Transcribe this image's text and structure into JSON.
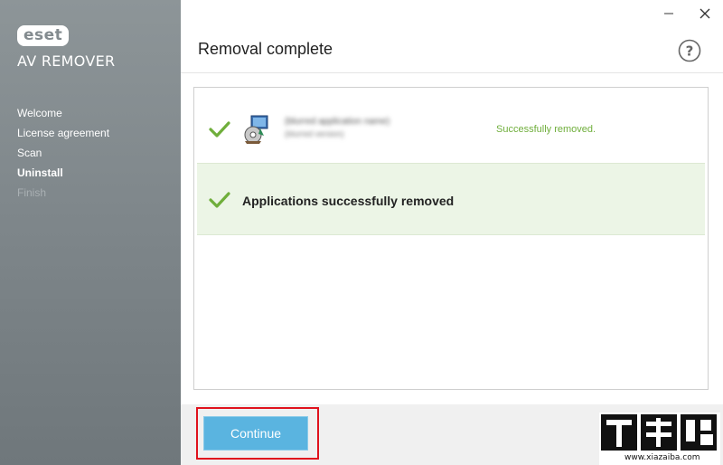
{
  "brand": {
    "logo_text": "eset",
    "product": "AV REMOVER"
  },
  "sidebar": {
    "items": [
      {
        "label": "Welcome",
        "state": "done"
      },
      {
        "label": "License agreement",
        "state": "done"
      },
      {
        "label": "Scan",
        "state": "done"
      },
      {
        "label": "Uninstall",
        "state": "active"
      },
      {
        "label": "Finish",
        "state": "disabled"
      }
    ]
  },
  "window": {
    "minimize_icon": "minimize-icon",
    "close_icon": "close-icon"
  },
  "header": {
    "title": "Removal complete",
    "help_icon": "help-icon"
  },
  "results": {
    "app": {
      "name": "(blurred application name)",
      "version": "(blurred version)",
      "status": "Successfully removed."
    },
    "summary": "Applications successfully removed"
  },
  "footer": {
    "continue_label": "Continue"
  },
  "watermark": {
    "url": "www.xiazaiba.com"
  },
  "colors": {
    "accent_blue": "#5ab4e0",
    "success_green": "#6fae3b",
    "highlight_red": "#e0121d",
    "sidebar_gray": "#7f878b"
  }
}
